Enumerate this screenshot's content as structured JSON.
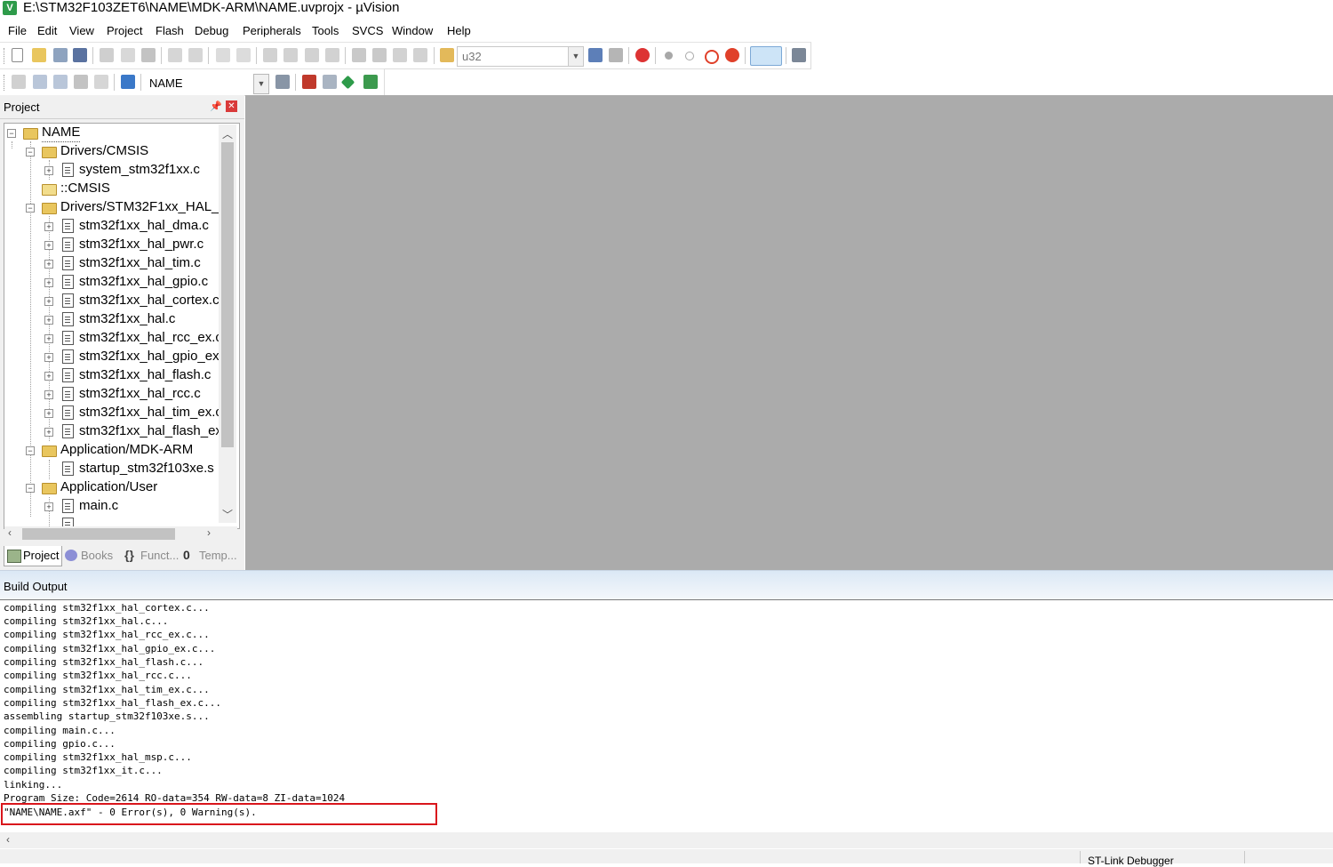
{
  "window": {
    "title": "E:\\STM32F103ZET6\\NAME\\MDK-ARM\\NAME.uvprojx - µVision",
    "app_icon": "uvision-icon"
  },
  "menu": [
    "File",
    "Edit",
    "View",
    "Project",
    "Flash",
    "Debug",
    "Peripherals",
    "Tools",
    "SVCS",
    "Window",
    "Help"
  ],
  "toolbar1": {
    "find_combo_value": "u32"
  },
  "toolbar2": {
    "target_combo_value": "NAME"
  },
  "project_pane": {
    "title": "Project",
    "tree": [
      {
        "label": "NAME",
        "type": "project",
        "expanded": true,
        "selected": true
      },
      {
        "label": "Drivers/CMSIS",
        "type": "group",
        "expanded": true
      },
      {
        "label": "system_stm32f1xx.c",
        "type": "file"
      },
      {
        "label": "::CMSIS",
        "type": "component"
      },
      {
        "label": "Drivers/STM32F1xx_HAL_",
        "type": "group",
        "expanded": true
      },
      {
        "label": "stm32f1xx_hal_dma.c",
        "type": "file"
      },
      {
        "label": "stm32f1xx_hal_pwr.c",
        "type": "file"
      },
      {
        "label": "stm32f1xx_hal_tim.c",
        "type": "file"
      },
      {
        "label": "stm32f1xx_hal_gpio.c",
        "type": "file"
      },
      {
        "label": "stm32f1xx_hal_cortex.c",
        "type": "file"
      },
      {
        "label": "stm32f1xx_hal.c",
        "type": "file"
      },
      {
        "label": "stm32f1xx_hal_rcc_ex.c",
        "type": "file"
      },
      {
        "label": "stm32f1xx_hal_gpio_ex",
        "type": "file"
      },
      {
        "label": "stm32f1xx_hal_flash.c",
        "type": "file"
      },
      {
        "label": "stm32f1xx_hal_rcc.c",
        "type": "file"
      },
      {
        "label": "stm32f1xx_hal_tim_ex.c",
        "type": "file"
      },
      {
        "label": "stm32f1xx_hal_flash_ex",
        "type": "file"
      },
      {
        "label": "Application/MDK-ARM",
        "type": "group",
        "expanded": true
      },
      {
        "label": "startup_stm32f103xe.s",
        "type": "file"
      },
      {
        "label": "Application/User",
        "type": "group",
        "expanded": true
      },
      {
        "label": "main.c",
        "type": "file"
      }
    ],
    "tabs": [
      "Project",
      "Books",
      "Funct...",
      "Temp..."
    ]
  },
  "build_output": {
    "title": "Build Output",
    "lines": [
      "compiling stm32f1xx_hal_cortex.c...",
      "compiling stm32f1xx_hal.c...",
      "compiling stm32f1xx_hal_rcc_ex.c...",
      "compiling stm32f1xx_hal_gpio_ex.c...",
      "compiling stm32f1xx_hal_flash.c...",
      "compiling stm32f1xx_hal_rcc.c...",
      "compiling stm32f1xx_hal_tim_ex.c...",
      "compiling stm32f1xx_hal_flash_ex.c...",
      "assembling startup_stm32f103xe.s...",
      "compiling main.c...",
      "compiling gpio.c...",
      "compiling stm32f1xx_hal_msp.c...",
      "compiling stm32f1xx_it.c...",
      "linking...",
      "Program Size: Code=2614 RO-data=354 RW-data=8 ZI-data=1024",
      "\"NAME\\NAME.axf\" - 0 Error(s), 0 Warning(s)."
    ],
    "highlight_color": "#d9161c"
  },
  "status": {
    "debugger": "ST-Link Debugger"
  }
}
